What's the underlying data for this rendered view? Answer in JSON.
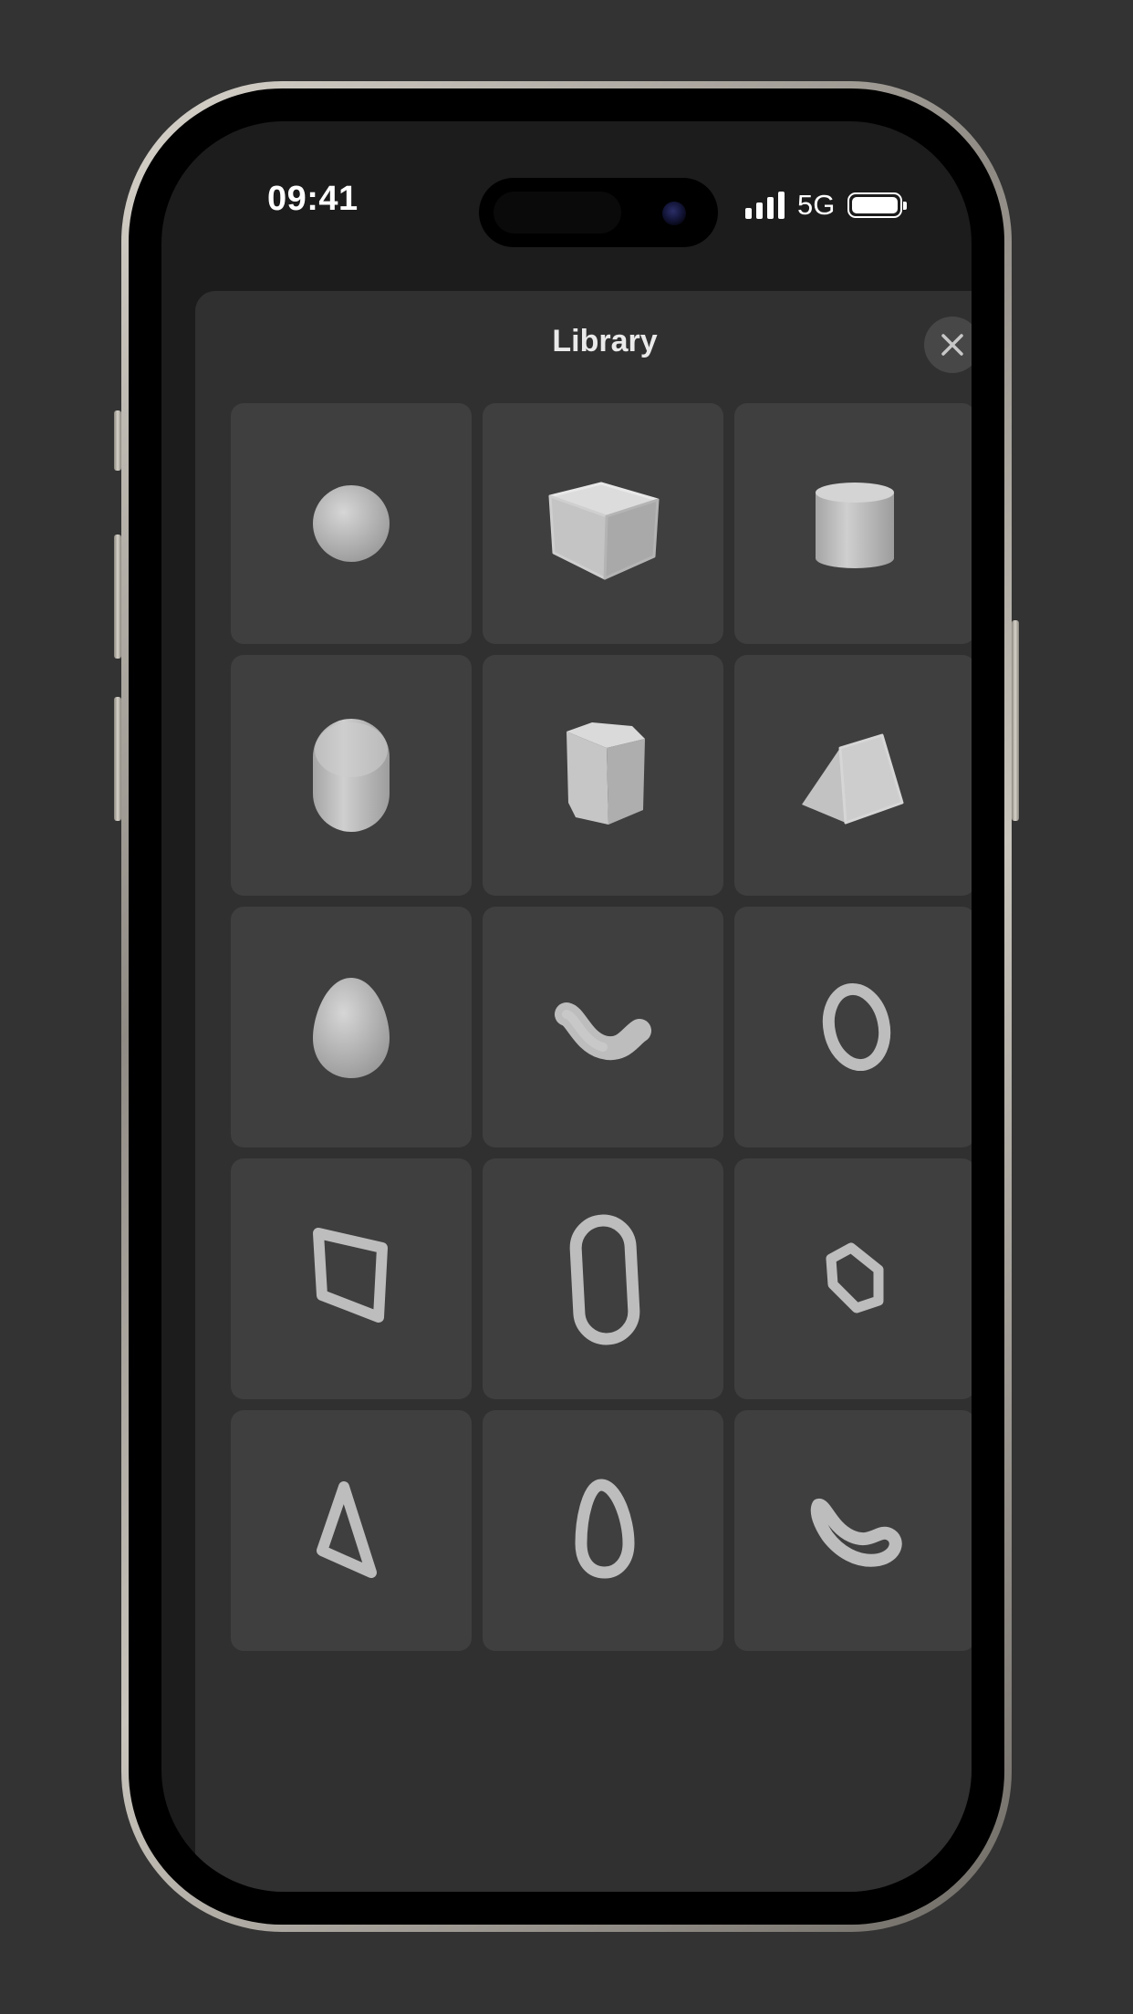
{
  "status_bar": {
    "time": "09:41",
    "network": "5G",
    "signal_bars": 4,
    "battery_level": 1.0
  },
  "sheet": {
    "title": "Library",
    "close_icon": "close-icon"
  },
  "library": {
    "items": [
      {
        "icon": "sphere-icon"
      },
      {
        "icon": "cube-icon"
      },
      {
        "icon": "cylinder-icon"
      },
      {
        "icon": "capsule-icon"
      },
      {
        "icon": "pentagonal-prism-icon"
      },
      {
        "icon": "triangular-prism-icon"
      },
      {
        "icon": "egg-icon"
      },
      {
        "icon": "curved-tube-icon"
      },
      {
        "icon": "torus-ring-icon"
      },
      {
        "icon": "square-loop-icon"
      },
      {
        "icon": "oval-loop-icon"
      },
      {
        "icon": "hexagon-loop-icon"
      },
      {
        "icon": "triangle-loop-icon"
      },
      {
        "icon": "egg-loop-icon"
      },
      {
        "icon": "bean-tube-icon"
      }
    ]
  },
  "colors": {
    "background": "#333333",
    "sheet": "#303030",
    "tile": "#3f3f3f",
    "shape": "#bdbdbd"
  }
}
